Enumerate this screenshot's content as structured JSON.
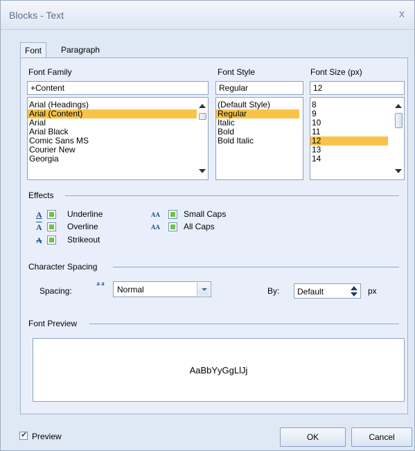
{
  "window": {
    "title": "Blocks - Text",
    "close_glyph": "x"
  },
  "tabs": [
    {
      "label": "Font",
      "active": true
    },
    {
      "label": "Paragraph",
      "active": false
    }
  ],
  "font_family": {
    "label": "Font Family",
    "value": "+Content",
    "items": [
      "Arial (Headings)",
      "Arial (Content)",
      "Arial",
      "Arial Black",
      "Comic Sans MS",
      "Courier New",
      "Georgia"
    ],
    "selected_index": 1
  },
  "font_style": {
    "label": "Font Style",
    "value": "Regular",
    "items": [
      "(Default Style)",
      "Regular",
      "Italic",
      "Bold",
      "Bold Italic"
    ],
    "selected_index": 1
  },
  "font_size": {
    "label": "Font Size (px)",
    "value": "12",
    "items": [
      "8",
      "9",
      "10",
      "11",
      "12",
      "13",
      "14"
    ],
    "selected_index": 4
  },
  "effects": {
    "title": "Effects",
    "items": [
      {
        "label": "Underline",
        "icon": "underline-icon",
        "glyph": "A"
      },
      {
        "label": "Overline",
        "icon": "overline-icon",
        "glyph": "A"
      },
      {
        "label": "Strikeout",
        "icon": "strikeout-icon",
        "glyph": "A"
      },
      {
        "label": "Small Caps",
        "icon": "small-caps-icon",
        "glyph": "AA"
      },
      {
        "label": "All Caps",
        "icon": "all-caps-icon",
        "glyph": "AA"
      }
    ]
  },
  "character_spacing": {
    "title": "Character Spacing",
    "spacing_label": "Spacing:",
    "spacing_icon_glyph": "a a",
    "spacing_value": "Normal",
    "by_label": "By:",
    "by_value": "Default",
    "unit": "px"
  },
  "font_preview": {
    "title": "Font Preview",
    "sample": "AaBbYyGgLlJj"
  },
  "footer": {
    "preview_label": "Preview",
    "preview_checked": true,
    "ok_label": "OK",
    "cancel_label": "Cancel"
  },
  "colors": {
    "selection": "#f9c34a",
    "checkbox_fill": "#6ec33f",
    "dialog_bg": "#dfe8f5"
  }
}
